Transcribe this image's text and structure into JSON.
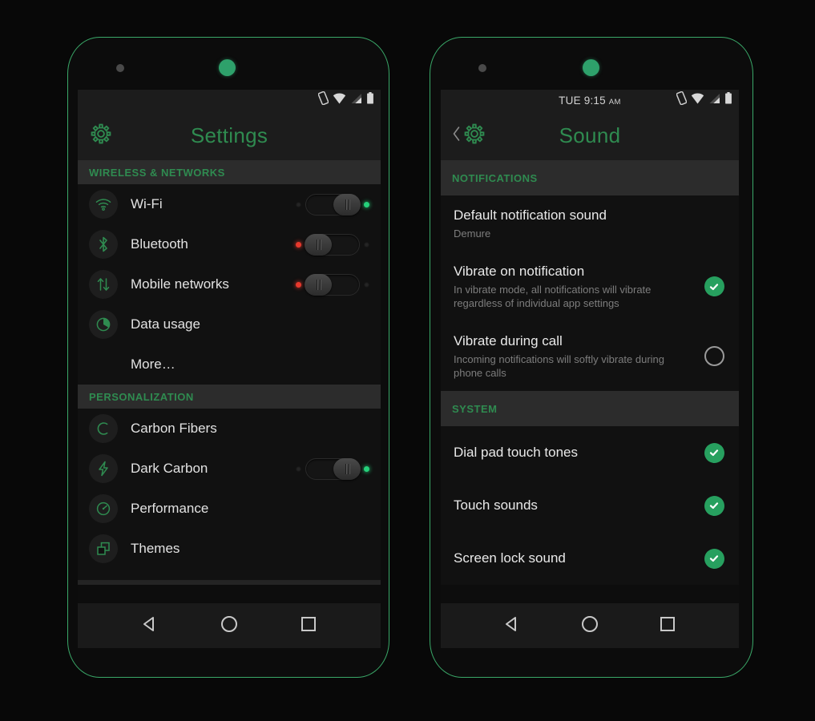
{
  "theme": {
    "accent_green": "#2f8b50",
    "led_green": "#25d07a",
    "led_red": "#e8382c",
    "check_green": "#27a05f",
    "screen_bg": "#111111",
    "bar_bg": "#1c1c1c",
    "section_bg": "#2c2c2c",
    "frame_outline": "#3aa868",
    "text_primary": "#e2e2e2",
    "text_secondary": "#7d7d7d"
  },
  "phone_left": {
    "name": "settings-screen",
    "statusbar": {
      "clock": "",
      "icons": [
        "vibrate-icon",
        "wifi-icon",
        "signal-icon",
        "battery-icon"
      ]
    },
    "actionbar": {
      "icon": "gear-icon",
      "title": "Settings"
    },
    "sections": [
      {
        "header": "WIRELESS & NETWORKS",
        "rows": [
          {
            "icon": "wifi-icon",
            "label": "Wi-Fi",
            "control": "toggle",
            "state": "on"
          },
          {
            "icon": "bluetooth-icon",
            "label": "Bluetooth",
            "control": "toggle",
            "state": "off"
          },
          {
            "icon": "mobile-networks-icon",
            "label": "Mobile networks",
            "control": "toggle",
            "state": "off"
          },
          {
            "icon": "data-usage-icon",
            "label": "Data usage",
            "control": "none",
            "state": ""
          },
          {
            "icon": "none",
            "label": "More…",
            "control": "none",
            "state": ""
          }
        ]
      },
      {
        "header": "PERSONALIZATION",
        "rows": [
          {
            "icon": "carbon-fibers-icon",
            "label": "Carbon Fibers",
            "control": "none",
            "state": ""
          },
          {
            "icon": "bolt-icon",
            "label": "Dark Carbon",
            "control": "toggle",
            "state": "on"
          },
          {
            "icon": "performance-icon",
            "label": "Performance",
            "control": "none",
            "state": ""
          },
          {
            "icon": "themes-icon",
            "label": "Themes",
            "control": "none",
            "state": ""
          }
        ]
      }
    ],
    "navbar": [
      "back-icon",
      "home-icon",
      "recents-icon"
    ]
  },
  "phone_right": {
    "name": "sound-screen",
    "statusbar": {
      "clock_day": "TUE",
      "clock_time": "9:15",
      "clock_ampm": "AM",
      "icons": [
        "vibrate-icon",
        "wifi-icon",
        "signal-icon",
        "battery-icon"
      ]
    },
    "actionbar": {
      "back": "chevron-left-icon",
      "icon": "gear-icon",
      "title": "Sound"
    },
    "sections": [
      {
        "header": "NOTIFICATIONS",
        "rows": [
          {
            "title": "Default notification sound",
            "sub": "Demure",
            "control": "none",
            "state": ""
          },
          {
            "title": "Vibrate on notification",
            "sub": "In vibrate mode, all notifications will vibrate regardless of individual app settings",
            "control": "checkbox",
            "state": "checked"
          },
          {
            "title": "Vibrate during call",
            "sub": "Incoming notifications will softly vibrate during phone calls",
            "control": "checkbox",
            "state": "unchecked"
          }
        ]
      },
      {
        "header": "SYSTEM",
        "rows": [
          {
            "title": "Dial pad touch tones",
            "sub": "",
            "control": "checkbox",
            "state": "checked"
          },
          {
            "title": "Touch sounds",
            "sub": "",
            "control": "checkbox",
            "state": "checked"
          },
          {
            "title": "Screen lock sound",
            "sub": "",
            "control": "checkbox",
            "state": "checked"
          }
        ]
      }
    ],
    "navbar": [
      "back-icon",
      "home-icon",
      "recents-icon"
    ]
  }
}
